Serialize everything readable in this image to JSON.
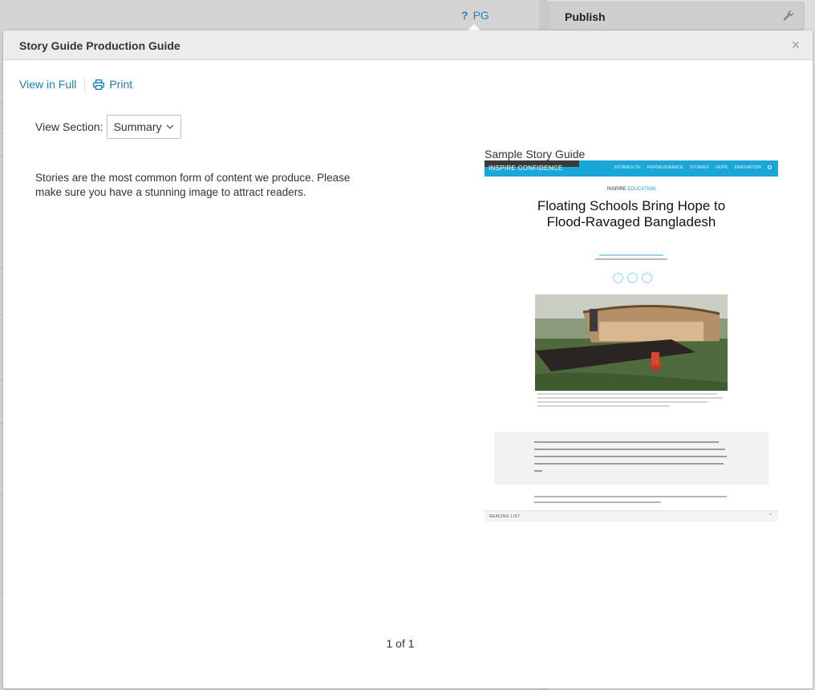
{
  "background": {
    "help_glyph": "?",
    "help_label": "PG",
    "publish_label": "Publish"
  },
  "modal": {
    "title": "Story Guide Production Guide",
    "close_glyph": "×",
    "toolbar": {
      "view_full_label": "View in Full",
      "print_label": "Print"
    },
    "view_section_label": "View Section:",
    "view_section_value": "Summary",
    "summary_text": "Stories are the most common form of content we produce. Please make sure you have a stunning image to attract readers.",
    "sample_caption": "Sample Story Guide",
    "sample": {
      "nav_brand": "INSPIRE CONFIDENCE",
      "nav_links": [
        "STORIES OF",
        "PERSEVERANCE",
        "STORIES",
        "HOPE",
        "INNOVATION"
      ],
      "kicker_prefix": "INSPIRE",
      "kicker_topic": "EDUCATION",
      "headline": "Floating Schools Bring Hope to Flood-Ravaged Bangladesh",
      "footer_label": "READING LIST",
      "footer_caret": "^",
      "accent_color": "#1aa6d6"
    },
    "pager": "1 of 1"
  },
  "colors": {
    "link": "#1f7fb5",
    "header_bg": "#ececec",
    "overlay": "#c9c9c9"
  }
}
